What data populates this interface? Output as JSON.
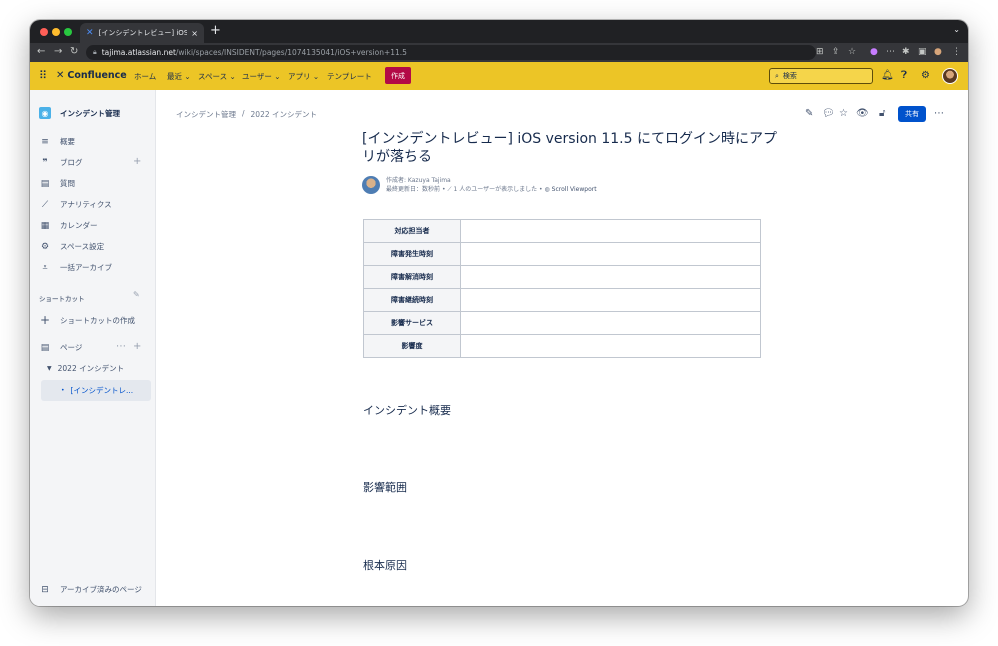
{
  "browser": {
    "tab_title": "[インシデントレビュー] iOS versio",
    "url_host": "tajima.atlassian.net",
    "url_path": "/wiki/spaces/INSIDENT/pages/1074135041/iOS+version+11.5"
  },
  "confluence": {
    "logo": "Confluence",
    "nav": [
      "ホーム",
      "最近",
      "スペース",
      "ユーザー",
      "アプリ",
      "テンプレート"
    ],
    "create": "作成",
    "search_placeholder": "検索",
    "colors": {
      "header": "#ecc526",
      "create": "#b30a46",
      "primary": "#0052cc"
    }
  },
  "sidebar": {
    "space_name": "インシデント管理",
    "items": [
      {
        "label": "概要",
        "icon": "overview-icon"
      },
      {
        "label": "ブログ",
        "icon": "quote-icon"
      },
      {
        "label": "質問",
        "icon": "question-icon"
      },
      {
        "label": "アナリティクス",
        "icon": "analytics-icon"
      },
      {
        "label": "カレンダー",
        "icon": "calendar-icon"
      },
      {
        "label": "スペース設定",
        "icon": "gear-icon"
      },
      {
        "label": "一括アーカイブ",
        "icon": "bulk-archive-icon"
      }
    ],
    "shortcuts_label": "ショートカット",
    "create_shortcut": "ショートカットの作成",
    "pages_label": "ページ",
    "tree_parent": "2022 インシデント",
    "tree_current": "[インシデントレ...",
    "archived": "アーカイブ済みのページ"
  },
  "page": {
    "breadcrumb": [
      "インシデント管理",
      "/",
      "2022 インシデント"
    ],
    "share": "共有",
    "title": "[インシデントレビュー] iOS version 11.5 にてログイン時にアプリが落ちる",
    "byline": {
      "author": "作成者: Kazuya Tajima",
      "updated": "最終更新日：数秒前",
      "views": "1 人のユーザーが表示しました",
      "viewport": "Scroll Viewport"
    },
    "table_rows": [
      "対応担当者",
      "障害発生時刻",
      "障害解消時刻",
      "障害継続時刻",
      "影響サービス",
      "影響度"
    ],
    "sections": [
      "インシデント概要",
      "影響範囲",
      "根本原因"
    ]
  }
}
